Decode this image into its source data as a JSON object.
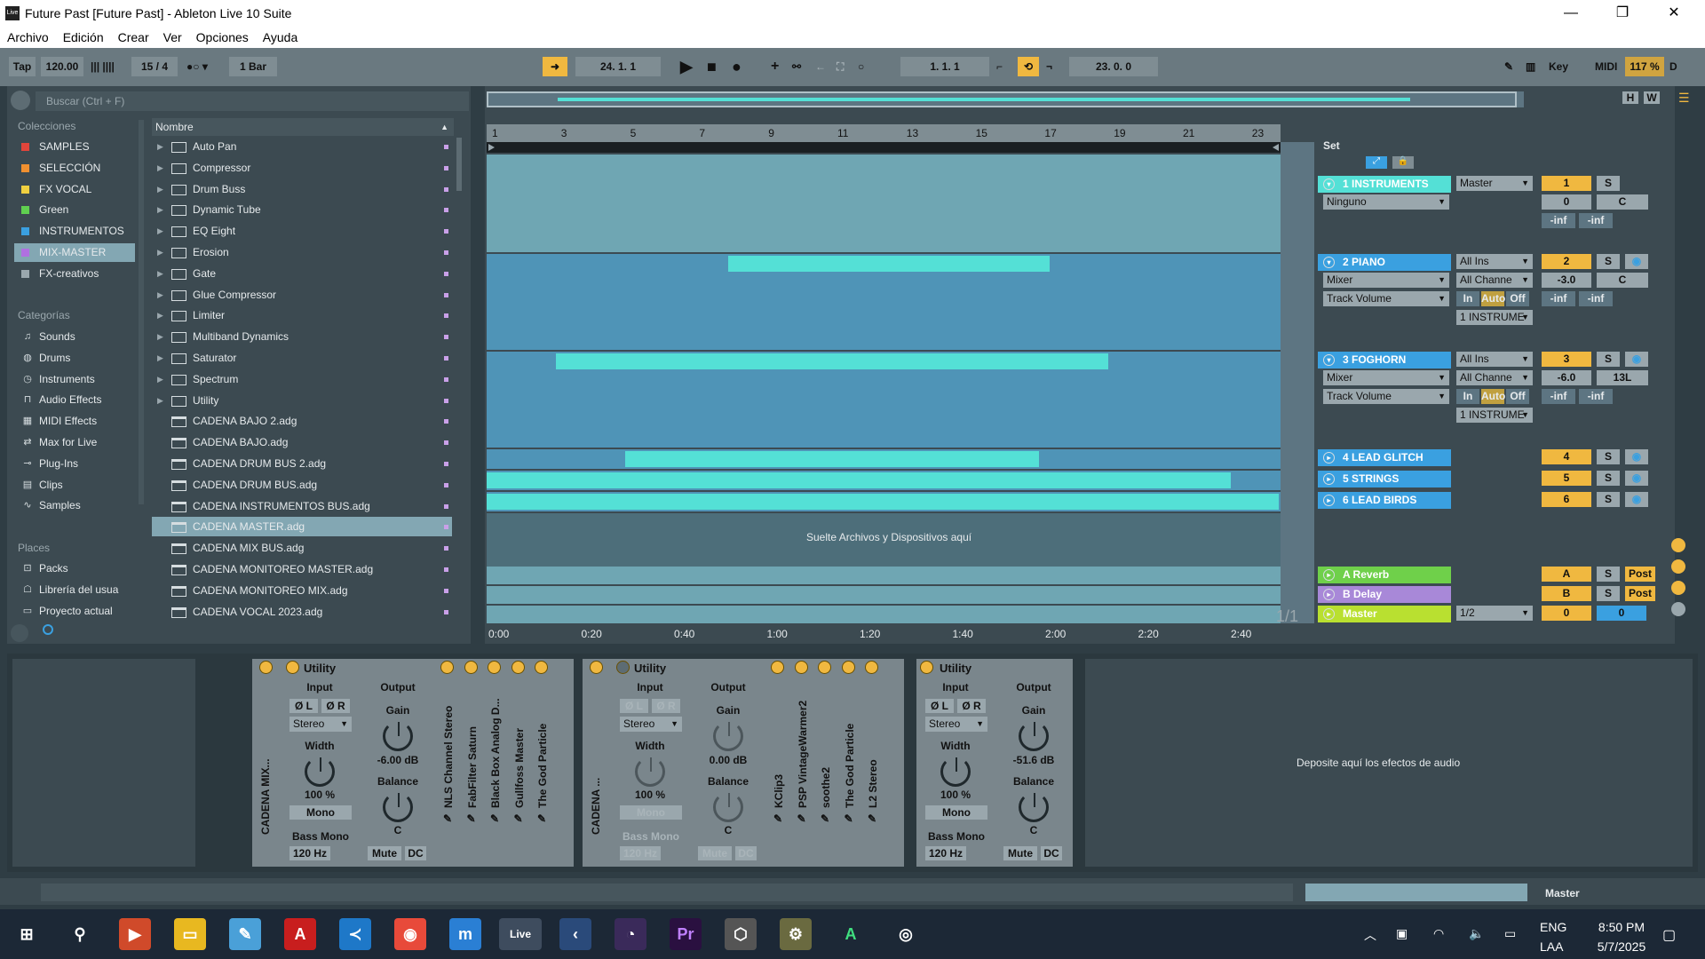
{
  "window": {
    "title": "Future Past  [Future Past] - Ableton Live 10 Suite",
    "app_icon": "Live",
    "minimize": "—",
    "maximize": "❐",
    "close": "✕"
  },
  "menu": [
    "Archivo",
    "Edición",
    "Crear",
    "Ver",
    "Opciones",
    "Ayuda"
  ],
  "control_bar": {
    "tap": "Tap",
    "tempo": "120.00",
    "signature": "15 / 4",
    "quantize": "1 Bar",
    "position": "24.   1.   1",
    "loop_start": "1.   1.   1",
    "loop_length": "23.   0.   0",
    "key": "Key",
    "midi": "MIDI",
    "cpu": "117 %",
    "d": "D"
  },
  "browser": {
    "search_placeholder": "Buscar (Ctrl + F)",
    "collections_label": "Colecciones",
    "collections": [
      {
        "label": "SAMPLES",
        "color": "#e0453b"
      },
      {
        "label": "SELECCIÓN",
        "color": "#f09030"
      },
      {
        "label": "FX VOCAL",
        "color": "#f0d040"
      },
      {
        "label": "Green",
        "color": "#60d050"
      },
      {
        "label": "INSTRUMENTOS",
        "color": "#3aa0e0"
      },
      {
        "label": "MIX-MASTER",
        "color": "#b070e0"
      },
      {
        "label": "FX-creativos",
        "color": "#9aa7ad"
      }
    ],
    "categories_label": "Categorías",
    "categories": [
      {
        "label": "Sounds",
        "icon": "note-icon"
      },
      {
        "label": "Drums",
        "icon": "drum-icon"
      },
      {
        "label": "Instruments",
        "icon": "clock-icon"
      },
      {
        "label": "Audio Effects",
        "icon": "audio-effects-icon"
      },
      {
        "label": "MIDI Effects",
        "icon": "midi-effects-icon"
      },
      {
        "label": "Max for Live",
        "icon": "max-icon"
      },
      {
        "label": "Plug-Ins",
        "icon": "plugin-icon"
      },
      {
        "label": "Clips",
        "icon": "clip-icon"
      },
      {
        "label": "Samples",
        "icon": "wave-icon"
      }
    ],
    "places_label": "Places",
    "places": [
      {
        "label": "Packs",
        "icon": "pack-icon"
      },
      {
        "label": "Librería del usua",
        "icon": "library-icon"
      },
      {
        "label": "Proyecto actual",
        "icon": "folder-icon"
      }
    ],
    "list_header": "Nombre",
    "items": [
      {
        "label": "Auto Pan",
        "type": "folder"
      },
      {
        "label": "Compressor",
        "type": "folder"
      },
      {
        "label": "Drum Buss",
        "type": "folder"
      },
      {
        "label": "Dynamic Tube",
        "type": "folder"
      },
      {
        "label": "EQ Eight",
        "type": "folder"
      },
      {
        "label": "Erosion",
        "type": "folder"
      },
      {
        "label": "Gate",
        "type": "folder"
      },
      {
        "label": "Glue Compressor",
        "type": "folder"
      },
      {
        "label": "Limiter",
        "type": "folder"
      },
      {
        "label": "Multiband Dynamics",
        "type": "folder"
      },
      {
        "label": "Saturator",
        "type": "folder"
      },
      {
        "label": "Spectrum",
        "type": "folder"
      },
      {
        "label": "Utility",
        "type": "folder"
      },
      {
        "label": "CADENA BAJO 2.adg",
        "type": "preset"
      },
      {
        "label": "CADENA BAJO.adg",
        "type": "preset"
      },
      {
        "label": "CADENA DRUM BUS 2.adg",
        "type": "preset"
      },
      {
        "label": "CADENA DRUM BUS.adg",
        "type": "preset"
      },
      {
        "label": "CADENA INSTRUMENTOS BUS.adg",
        "type": "preset"
      },
      {
        "label": "CADENA MASTER.adg",
        "type": "preset",
        "selected": true
      },
      {
        "label": "CADENA MIX BUS.adg",
        "type": "preset"
      },
      {
        "label": "CADENA MONITOREO MASTER.adg",
        "type": "preset"
      },
      {
        "label": "CADENA MONITOREO MIX.adg",
        "type": "preset"
      },
      {
        "label": "CADENA VOCAL 2023.adg",
        "type": "preset"
      }
    ]
  },
  "arrangement": {
    "overview_h": "H",
    "overview_w": "W",
    "bar_ruler": [
      "1",
      "3",
      "5",
      "7",
      "9",
      "11",
      "13",
      "15",
      "17",
      "19",
      "21",
      "23"
    ],
    "time_ruler": [
      "0:00",
      "0:20",
      "0:40",
      "1:00",
      "1:20",
      "1:40",
      "2:00",
      "2:20",
      "2:40"
    ],
    "drop_text": "Suelte Archivos y Dispositivos aquí",
    "page": "1/1",
    "set_label": "Set",
    "tracks": [
      {
        "name": "1 INSTRUMENTS",
        "color": "#54e0d6",
        "io1": "Master",
        "num": "1",
        "s": "S",
        "pan": "C",
        "vol": "0",
        "row2": "Ninguno",
        "meter1": "-inf",
        "meter2": "-inf"
      },
      {
        "name": "2 PIANO",
        "color": "#3aa0e0",
        "io1": "All Ins",
        "io2": "All Channe",
        "num": "2",
        "s": "S",
        "pan": "C",
        "vol": "-3.0",
        "row2": "Mixer",
        "row3": "Track Volume",
        "in": "In",
        "auto": "Auto",
        "off": "Off",
        "out": "1 INSTRUME",
        "meter1": "-inf",
        "meter2": "-inf"
      },
      {
        "name": "3 FOGHORN",
        "color": "#3aa0e0",
        "io1": "All Ins",
        "io2": "All Channe",
        "num": "3",
        "s": "S",
        "pan": "13L",
        "vol": "-6.0",
        "row2": "Mixer",
        "row3": "Track Volume",
        "in": "In",
        "auto": "Auto",
        "off": "Off",
        "out": "1 INSTRUME",
        "meter1": "-inf",
        "meter2": "-inf"
      },
      {
        "name": "4 LEAD GLITCH",
        "color": "#3aa0e0",
        "num": "4",
        "s": "S"
      },
      {
        "name": "5 STRINGS",
        "color": "#3aa0e0",
        "num": "5",
        "s": "S"
      },
      {
        "name": "6 LEAD BIRDS",
        "color": "#3aa0e0",
        "num": "6",
        "s": "S"
      },
      {
        "name": "A Reverb",
        "color": "#6fd04a",
        "num": "A",
        "s": "S",
        "post": "Post"
      },
      {
        "name": "B Delay",
        "color": "#a888d8",
        "num": "B",
        "s": "S",
        "post": "Post"
      },
      {
        "name": "Master",
        "color": "#b9e030",
        "io1": "1/2",
        "num": "0",
        "vol": "0"
      }
    ]
  },
  "devices": [
    {
      "rack_label": "CADENA MIX...",
      "title": "Utility",
      "input": "Input",
      "output": "Output",
      "l": "Ø L",
      "r": "Ø R",
      "mode": "Stereo",
      "gain": "Gain",
      "gain_val": "-6.00 dB",
      "width": "Width",
      "width_val": "100 %",
      "balance": "Balance",
      "balance_val": "C",
      "mono": "Mono",
      "bassmono": "Bass Mono",
      "hz": "120 Hz",
      "mute": "Mute",
      "dc": "DC",
      "chain": [
        "NLS Channel Stereo",
        "FabFilter Saturn",
        "Black Box Analog D...",
        "Gullfoss Master",
        "The God Particle"
      ]
    },
    {
      "rack_label": "CADENA ...",
      "title": "Utility",
      "input": "Input",
      "output": "Output",
      "l": "Ø L",
      "r": "Ø R",
      "mode": "Stereo",
      "gain": "Gain",
      "gain_val": "0.00 dB",
      "width": "Width",
      "width_val": "100 %",
      "balance": "Balance",
      "balance_val": "C",
      "mono": "Mono",
      "bassmono": "Bass Mono",
      "hz": "120 Hz",
      "mute": "Mute",
      "dc": "DC",
      "chain": [
        "KClip3",
        "PSP VintageWarmer2",
        "soothe2",
        "The God Particle",
        "L2 Stereo"
      ]
    },
    {
      "title": "Utility",
      "input": "Input",
      "output": "Output",
      "l": "Ø L",
      "r": "Ø R",
      "mode": "Stereo",
      "gain": "Gain",
      "gain_val": "-51.6 dB",
      "width": "Width",
      "width_val": "100 %",
      "balance": "Balance",
      "balance_val": "C",
      "mono": "Mono",
      "bassmono": "Bass Mono",
      "hz": "120 Hz",
      "mute": "Mute",
      "dc": "DC"
    }
  ],
  "device_drop_text": "Deposite aquí los efectos de audio",
  "status": {
    "track": "Master"
  },
  "taskbar": {
    "lang1": "ENG",
    "lang2": "LAA",
    "time": "8:50 PM",
    "date": "5/7/2025"
  }
}
